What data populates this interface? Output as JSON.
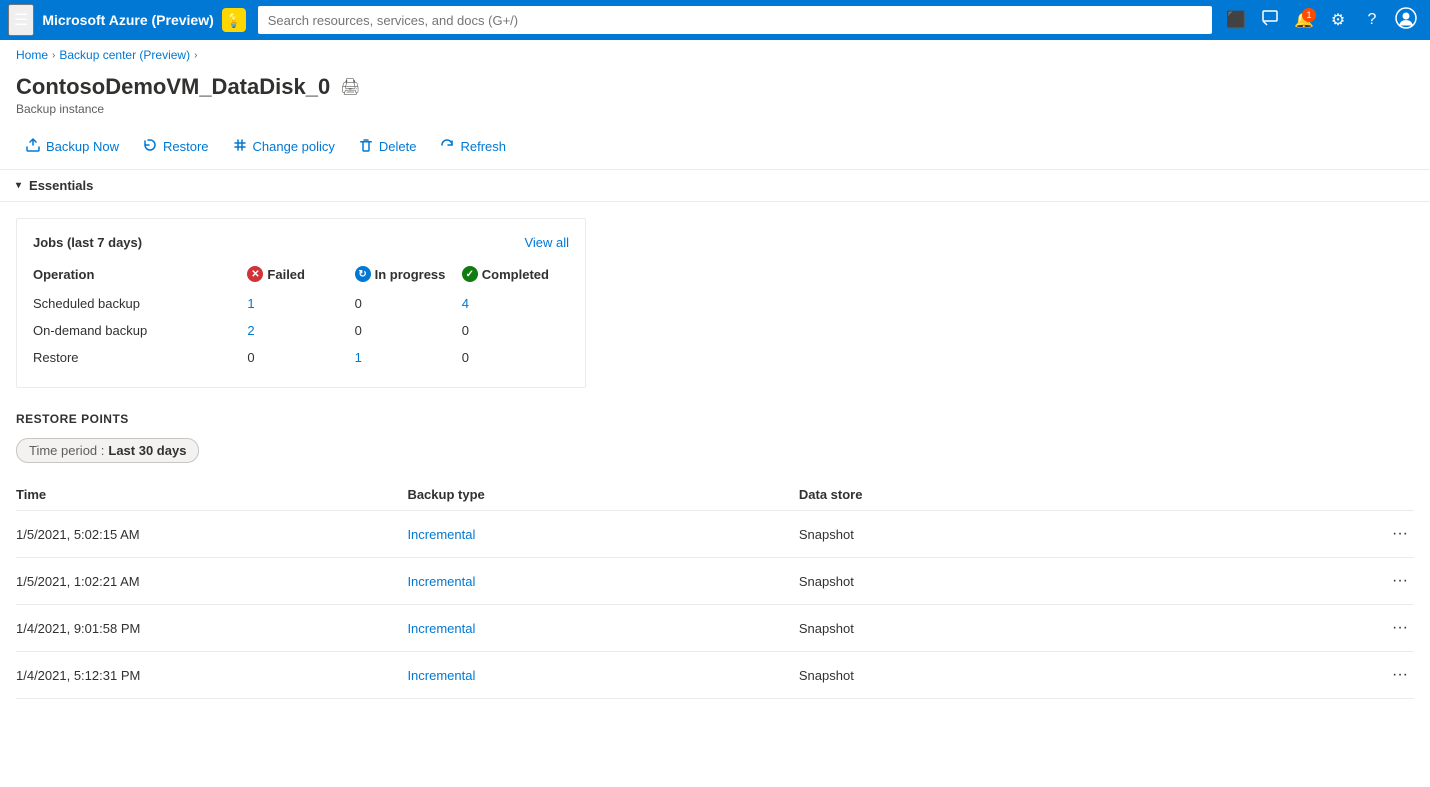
{
  "topbar": {
    "title": "Microsoft Azure (Preview)",
    "search_placeholder": "Search resources, services, and docs (G+/)",
    "bulb_icon": "💡",
    "notification_count": "1",
    "icons": {
      "cloud": "🖥",
      "feedback": "📋",
      "notifications": "🔔",
      "settings": "⚙",
      "help": "?",
      "account": "😊"
    }
  },
  "breadcrumb": {
    "items": [
      "Home",
      "Backup center (Preview)"
    ]
  },
  "page": {
    "title": "ContosoDemoVM_DataDisk_0",
    "subtitle": "Backup instance",
    "print_icon": "🖨"
  },
  "toolbar": {
    "backup_now": "Backup Now",
    "restore": "Restore",
    "change_policy": "Change policy",
    "delete": "Delete",
    "refresh": "Refresh"
  },
  "essentials": {
    "label": "Essentials"
  },
  "jobs": {
    "title": "Jobs (last 7 days)",
    "view_all": "View all",
    "headers": {
      "operation": "Operation",
      "failed": "Failed",
      "in_progress": "In progress",
      "completed": "Completed"
    },
    "rows": [
      {
        "operation": "Scheduled backup",
        "failed": "1",
        "in_progress": "0",
        "completed": "4",
        "failed_link": true,
        "completed_link": true
      },
      {
        "operation": "On-demand backup",
        "failed": "2",
        "in_progress": "0",
        "completed": "0",
        "failed_link": true,
        "completed_link": false
      },
      {
        "operation": "Restore",
        "failed": "0",
        "in_progress": "1",
        "completed": "0",
        "failed_link": false,
        "in_progress_link": true
      }
    ]
  },
  "restore_points": {
    "title": "RESTORE POINTS",
    "time_period_label": "Time period :",
    "time_period_value": "Last 30 days",
    "table_headers": {
      "time": "Time",
      "backup_type": "Backup type",
      "data_store": "Data store"
    },
    "rows": [
      {
        "time": "1/5/2021, 5:02:15 AM",
        "backup_type": "Incremental",
        "data_store": "Snapshot"
      },
      {
        "time": "1/5/2021, 1:02:21 AM",
        "backup_type": "Incremental",
        "data_store": "Snapshot"
      },
      {
        "time": "1/4/2021, 9:01:58 PM",
        "backup_type": "Incremental",
        "data_store": "Snapshot"
      },
      {
        "time": "1/4/2021, 5:12:31 PM",
        "backup_type": "Incremental",
        "data_store": "Snapshot"
      }
    ]
  }
}
